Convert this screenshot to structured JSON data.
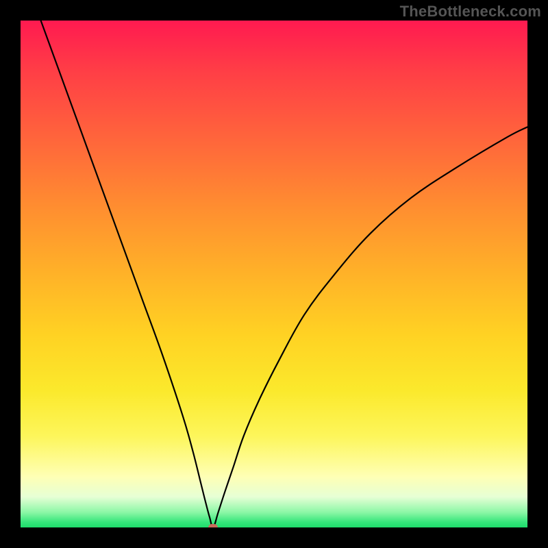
{
  "watermark": "TheBottleneck.com",
  "chart_data": {
    "type": "line",
    "title": "",
    "xlabel": "",
    "ylabel": "",
    "xlim": [
      0,
      100
    ],
    "ylim": [
      0,
      100
    ],
    "grid": false,
    "legend": false,
    "marker": {
      "x": 38,
      "y": 0
    },
    "series": [
      {
        "name": "left-branch",
        "x": [
          4,
          8,
          12,
          16,
          20,
          24,
          28,
          32,
          34,
          35.5,
          36.5,
          37.3,
          38
        ],
        "values": [
          100,
          89,
          78,
          67,
          56,
          45,
          34,
          22,
          15,
          9,
          5,
          2,
          0
        ]
      },
      {
        "name": "right-branch",
        "x": [
          38,
          39,
          40.3,
          42,
          44,
          47,
          51,
          56,
          62,
          69,
          77,
          86,
          96,
          100
        ],
        "values": [
          0,
          3,
          7,
          12,
          18,
          25,
          33,
          42,
          50,
          58,
          65,
          71,
          77,
          79
        ]
      }
    ],
    "gradient_bands": [
      {
        "pct": 0,
        "color": "#ff1a50"
      },
      {
        "pct": 10,
        "color": "#ff3e46"
      },
      {
        "pct": 25,
        "color": "#ff6a3a"
      },
      {
        "pct": 37,
        "color": "#ff8e30"
      },
      {
        "pct": 50,
        "color": "#ffb228"
      },
      {
        "pct": 62,
        "color": "#ffd223"
      },
      {
        "pct": 73,
        "color": "#fbe92c"
      },
      {
        "pct": 82,
        "color": "#fdf65b"
      },
      {
        "pct": 90,
        "color": "#feffb5"
      },
      {
        "pct": 94,
        "color": "#e6ffd5"
      },
      {
        "pct": 97,
        "color": "#8cf7a6"
      },
      {
        "pct": 99,
        "color": "#34e57a"
      },
      {
        "pct": 100,
        "color": "#1edc6b"
      }
    ]
  }
}
